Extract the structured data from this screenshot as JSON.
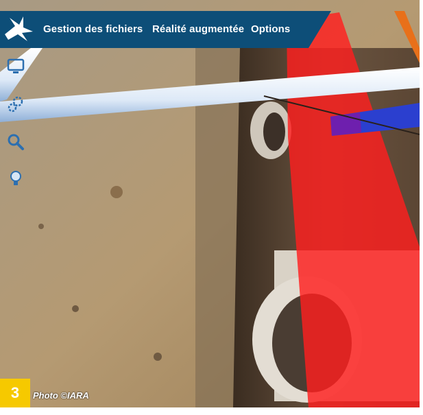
{
  "app": {
    "menu": [
      "Gestion des fichiers",
      "Réalité augmentée",
      "Options"
    ],
    "brand_color": "#0d4e78",
    "logo_icon": "bird-logo-icon"
  },
  "toolbar": {
    "icons": [
      "monitor-icon",
      "gears-icon",
      "search-icon",
      "lightbulb-icon"
    ]
  },
  "overlay": {
    "pipe_colors": {
      "red": "#ff1e1e",
      "white": "#eaf3ff",
      "blue": "#2b3fcf",
      "orange": "#e8701a"
    }
  },
  "caption": {
    "number": "3",
    "credit": "Photo ©IARA",
    "badge_color": "#f6c900"
  }
}
